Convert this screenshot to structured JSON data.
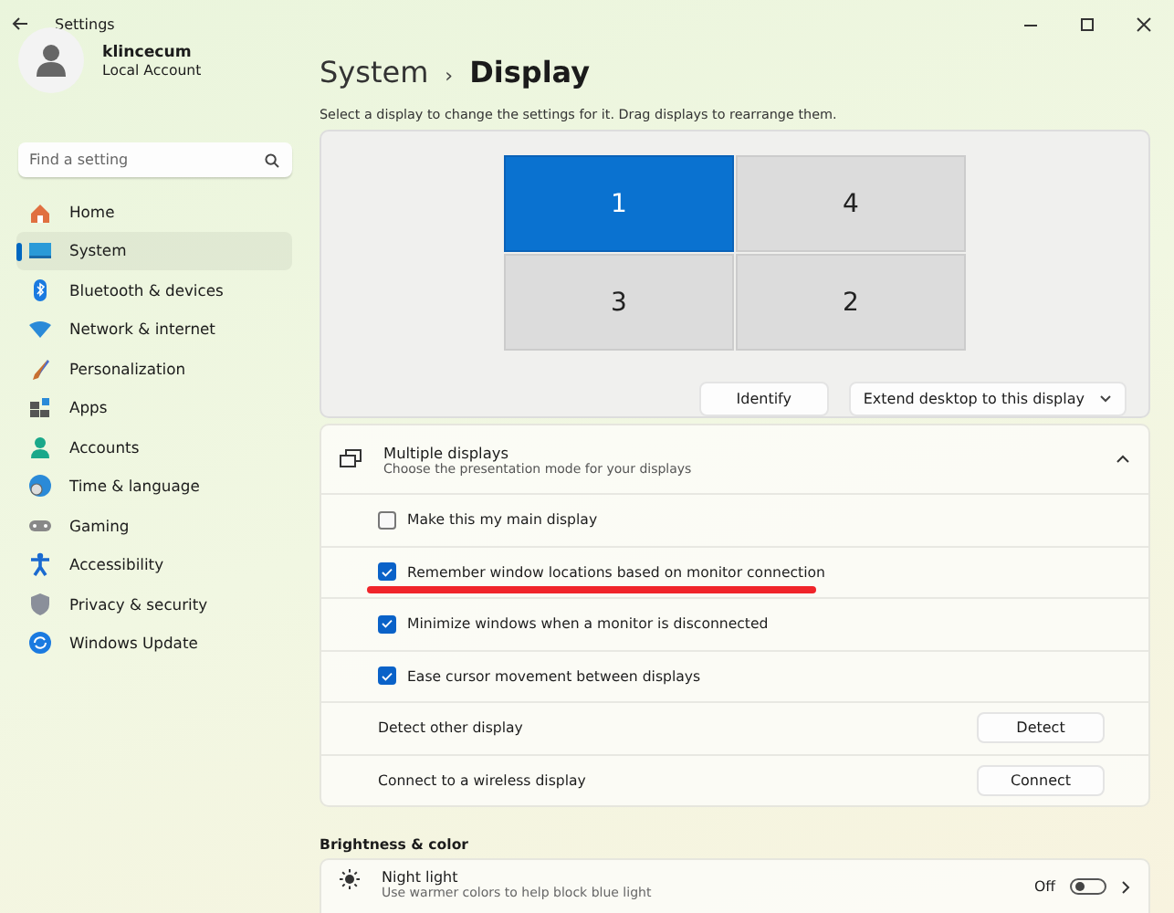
{
  "window": {
    "title": "Settings"
  },
  "user": {
    "name": "klincecum",
    "account": "Local Account"
  },
  "search": {
    "placeholder": "Find a setting"
  },
  "nav": [
    {
      "label": "Home",
      "selected": false
    },
    {
      "label": "System",
      "selected": true
    },
    {
      "label": "Bluetooth & devices",
      "selected": false
    },
    {
      "label": "Network & internet",
      "selected": false
    },
    {
      "label": "Personalization",
      "selected": false
    },
    {
      "label": "Apps",
      "selected": false
    },
    {
      "label": "Accounts",
      "selected": false
    },
    {
      "label": "Time & language",
      "selected": false
    },
    {
      "label": "Gaming",
      "selected": false
    },
    {
      "label": "Accessibility",
      "selected": false
    },
    {
      "label": "Privacy & security",
      "selected": false
    },
    {
      "label": "Windows Update",
      "selected": false
    }
  ],
  "breadcrumb": {
    "parent": "System",
    "separator": "›",
    "current": "Display"
  },
  "instructions": "Select a display to change the settings for it. Drag displays to rearrange them.",
  "displays": [
    {
      "label": "1",
      "selected": true
    },
    {
      "label": "4",
      "selected": false
    },
    {
      "label": "3",
      "selected": false
    },
    {
      "label": "2",
      "selected": false
    }
  ],
  "identify_button": "Identify",
  "extend_dropdown": {
    "value": "Extend desktop to this display"
  },
  "multiple_displays": {
    "title": "Multiple displays",
    "subtitle": "Choose the presentation mode for your displays",
    "expanded": true,
    "rows": [
      {
        "kind": "checkbox",
        "label": "Make this my main display",
        "checked": false,
        "underlined": false
      },
      {
        "kind": "checkbox",
        "label": "Remember window locations based on monitor connection",
        "checked": true,
        "underlined": true
      },
      {
        "kind": "checkbox",
        "label": "Minimize windows when a monitor is disconnected",
        "checked": true,
        "underlined": false
      },
      {
        "kind": "checkbox",
        "label": "Ease cursor movement between displays",
        "checked": true,
        "underlined": false
      },
      {
        "kind": "button",
        "label": "Detect other display",
        "button": "Detect"
      },
      {
        "kind": "button",
        "label": "Connect to a wireless display",
        "button": "Connect"
      }
    ]
  },
  "brightness_section": {
    "heading": "Brightness & color"
  },
  "night_light": {
    "title": "Night light",
    "subtitle": "Use warmer colors to help block blue light",
    "state": "Off",
    "on": false
  }
}
